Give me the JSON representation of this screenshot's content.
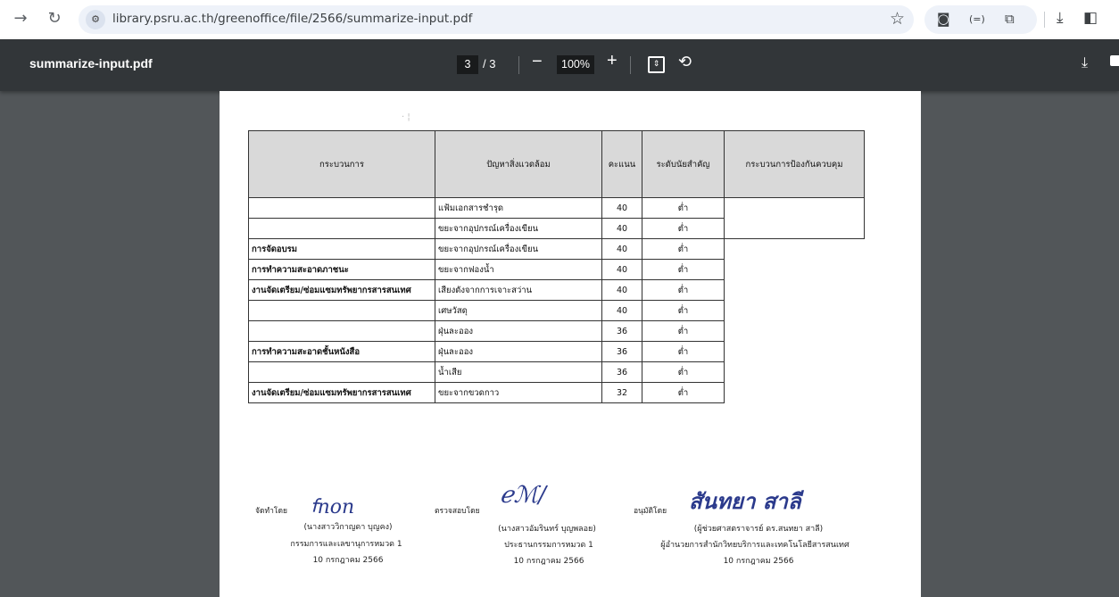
{
  "browser": {
    "url": "library.psru.ac.th/greenoffice/file/2566/summarize-input.pdf",
    "icons": [
      "forward-icon",
      "reload-icon",
      "site-info-icon",
      "bookmark-star-icon",
      "screenshot-icon",
      "extension-icon",
      "puzzle-icon",
      "download-icon",
      "side-panel-icon"
    ]
  },
  "pdf_toolbar": {
    "title": "summarize-input.pdf",
    "current_page": "3",
    "page_total": "/ 3",
    "zoom": "100%",
    "zoom_out": "−",
    "zoom_in": "+"
  },
  "table": {
    "headers": [
      "กระบวนการ",
      "ปัญหาสิ่งแวดล้อม",
      "คะแนน",
      "ระดับนัยสำคัญ",
      "กระบวนการป้องกันควบคุม"
    ],
    "rows": [
      [
        "",
        "แฟ้มเอกสารชำรุด",
        "40",
        "ต่ำ"
      ],
      [
        "",
        "ขยะจากอุปกรณ์เครื่องเขียน",
        "40",
        "ต่ำ"
      ],
      [
        "การจัดอบรม",
        "ขยะจากอุปกรณ์เครื่องเขียน",
        "40",
        "ต่ำ"
      ],
      [
        "การทำความสะอาดภาชนะ",
        "ขยะจากฟองน้ำ",
        "40",
        "ต่ำ"
      ],
      [
        "งานจัดเตรียม/ซ่อมแซมทรัพยากรสารสนเทศ",
        "เสียงดังจากการเจาะสว่าน",
        "40",
        "ต่ำ"
      ],
      [
        "",
        "เศษวัสดุ",
        "40",
        "ต่ำ"
      ],
      [
        "",
        "ฝุ่นละออง",
        "36",
        "ต่ำ"
      ],
      [
        "การทำความสะอาดชั้นหนังสือ",
        "ฝุ่นละออง",
        "36",
        "ต่ำ"
      ],
      [
        "",
        "น้ำเสีย",
        "36",
        "ต่ำ"
      ],
      [
        "งานจัดเตรียม/ซ่อมแซมทรัพยากรสารสนเทศ",
        "ขยะจากขวดกาว",
        "32",
        "ต่ำ"
      ]
    ]
  },
  "signatures": {
    "prepared": {
      "label": "จัดทำโดย",
      "name": "(นางสาววิกาญดา บุญคง)",
      "position": "กรรมการและเลขานุการหมวด 1",
      "date": "10 กรกฎาคม 2566"
    },
    "checked": {
      "label": "ตรวจสอบโดย",
      "name": "(นางสาวอัมรินทร์ บุญพลอย)",
      "position": "ประธานกรรมการหมวด 1",
      "date": "10 กรกฎาคม 2566"
    },
    "approved": {
      "label": "อนุมัติโดย",
      "signature": "สันทยา สาลี",
      "name": "(ผู้ช่วยศาสตราจารย์ ดร.สนทยา สาลี)",
      "position": "ผู้อำนวยการสำนักวิทยบริการและเทคโนโลยีสารสนเทศ",
      "date": "10 กรกฎาคม 2566"
    }
  }
}
